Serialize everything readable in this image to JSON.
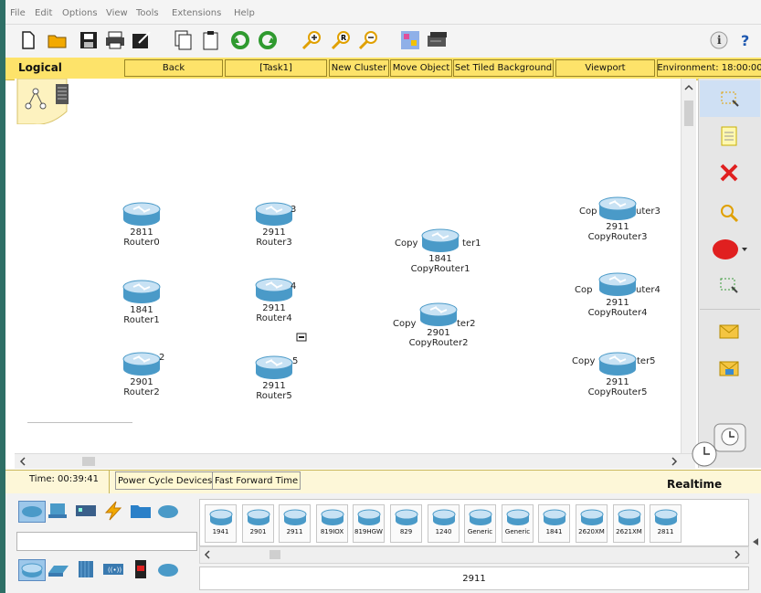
{
  "menu": {
    "items": [
      "File",
      "Edit",
      "Options",
      "View",
      "Tools",
      "Extensions",
      "Help"
    ]
  },
  "logical_bar": {
    "label": "Logical",
    "buttons": {
      "back": "Back",
      "task": "[Task1]",
      "new_cluster": "New Cluster",
      "move_object": "Move Object",
      "set_tiled_background": "Set Tiled Background",
      "viewport": "Viewport",
      "environment": "Environment: 18:00:00"
    }
  },
  "devices": [
    {
      "model": "2811",
      "name": "Router0"
    },
    {
      "model": "2911",
      "name": "Router3"
    },
    {
      "model": "1841",
      "name": "Router1"
    },
    {
      "model": "2911",
      "name": "Router4"
    },
    {
      "model": "2901",
      "name": "Router2"
    },
    {
      "model": "2911",
      "name": "Router5"
    },
    {
      "model": "1841",
      "name": "CopyRouter1"
    },
    {
      "model": "2901",
      "name": "CopyRouter2"
    },
    {
      "model": "2911",
      "name": "CopyRouter3"
    },
    {
      "model": "2911",
      "name": "CopyRouter4"
    },
    {
      "model": "2911",
      "name": "CopyRouter5"
    }
  ],
  "overlay_text": {
    "router3_frag": "3",
    "router4_frag": "4",
    "router2_frag": "2",
    "router5_frag": "5",
    "copy1_left": "Copy",
    "copy1_right": "ter1",
    "copy2_left": "Copy",
    "copy2_right": "ter2",
    "copy3_left": "Cop",
    "copy3_right": "uter3",
    "copy4_left": "Cop",
    "copy4_right": "uter4",
    "copy5_left": "Copy",
    "copy5_right": "ter5"
  },
  "status": {
    "time": "Time: 00:39:41",
    "power_cycle": "Power Cycle Devices",
    "fast_forward": "Fast Forward Time",
    "mode": "Realtime"
  },
  "router_models": [
    "1941",
    "2901",
    "2911",
    "819IOX",
    "819HGW",
    "829",
    "1240",
    "Generic",
    "Generic",
    "1841",
    "2620XM",
    "2621XM",
    "2811"
  ],
  "selected_model": "2911",
  "colors": {
    "logical_bar": "#fde36a",
    "status_bar": "#fdf7d8",
    "router_blue": "#4a9ac8",
    "delete_red": "#e02020"
  }
}
